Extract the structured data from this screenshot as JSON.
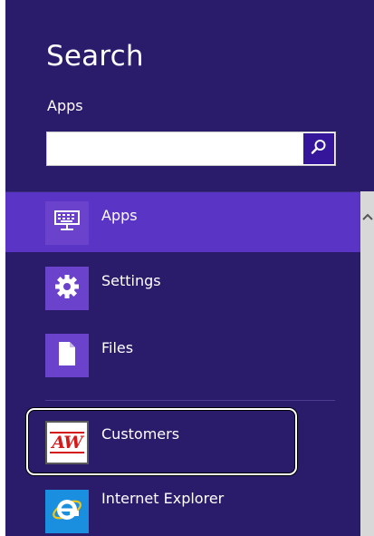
{
  "search": {
    "title": "Search",
    "scope": "Apps",
    "input_value": "",
    "placeholder": "",
    "button_icon": "search-icon"
  },
  "categories": [
    {
      "label": "Apps",
      "icon": "keyboard-icon",
      "selected": true
    },
    {
      "label": "Settings",
      "icon": "gear-icon",
      "selected": false
    },
    {
      "label": "Files",
      "icon": "file-icon",
      "selected": false
    }
  ],
  "results": [
    {
      "label": "Customers",
      "tile_text": "AW",
      "highlighted": true
    },
    {
      "label": "Internet Explorer",
      "icon": "internet-explorer-icon",
      "highlighted": false
    }
  ],
  "colors": {
    "panel_background": "#2a1b6b",
    "selected_background": "#5a34c4",
    "tile_purple": "#6a42cc",
    "search_button": "#35159a",
    "aw_red": "#d41a1a",
    "ie_blue": "#1a8fe0",
    "scrollbar": "#d8d8d8"
  },
  "scrollbar": {
    "up_icon": "chevron-up-icon"
  }
}
